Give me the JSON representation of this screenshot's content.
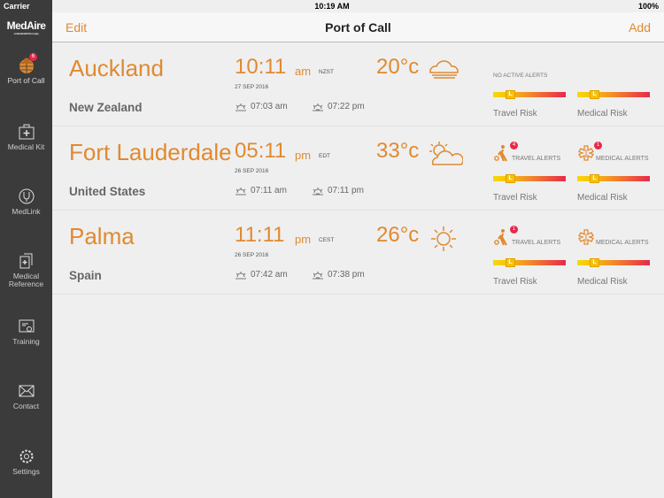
{
  "status": {
    "carrier": "Carrier",
    "time": "10:19 AM",
    "battery": "100%"
  },
  "brand": {
    "logo": "MedAire",
    "tagline": "An International SOS Company"
  },
  "sidebar": {
    "items": [
      {
        "label": "Port of Call",
        "icon": "globe-pin-icon",
        "badge": "6"
      },
      {
        "label": "Medical Kit",
        "icon": "medical-kit-icon"
      },
      {
        "label": "MedLink",
        "icon": "stethoscope-icon"
      },
      {
        "label": "Medical Reference",
        "icon": "documents-icon"
      },
      {
        "label": "Training",
        "icon": "certificate-icon"
      },
      {
        "label": "Contact",
        "icon": "envelope-icon"
      },
      {
        "label": "Settings",
        "icon": "gear-icon"
      }
    ]
  },
  "navbar": {
    "edit": "Edit",
    "title": "Port of Call",
    "add": "Add"
  },
  "colors": {
    "accent": "#e08a30",
    "sidebar": "#3b3b3b",
    "badge": "#e8284a"
  },
  "ports": [
    {
      "city": "Auckland",
      "country": "New Zealand",
      "time": "10:11",
      "ampm": "am",
      "tz": "NZST",
      "date": "27 SEP 2016",
      "sunrise": "07:03 am",
      "sunset": "07:22 pm",
      "temp": "20°c",
      "weather": "fog-icon",
      "no_alerts": "NO ACTIVE ALERTS",
      "travel_risk": "Travel Risk",
      "medical_risk": "Medical Risk",
      "risk_level": "L"
    },
    {
      "city": "Fort Lauderdale",
      "country": "United States",
      "time": "05:11",
      "ampm": "pm",
      "tz": "EDT",
      "date": "26 SEP 2016",
      "sunrise": "07:11 am",
      "sunset": "07:11 pm",
      "temp": "33°c",
      "weather": "partly-cloudy-icon",
      "travel_alerts": "TRAVEL ALERTS",
      "travel_count": "4",
      "medical_alerts": "MEDICAL ALERTS",
      "medical_count": "1",
      "travel_risk": "Travel Risk",
      "medical_risk": "Medical Risk",
      "risk_level": "L"
    },
    {
      "city": "Palma",
      "country": "Spain",
      "time": "11:11",
      "ampm": "pm",
      "tz": "CEST",
      "date": "26 SEP 2016",
      "sunrise": "07:42 am",
      "sunset": "07:38 pm",
      "temp": "26°c",
      "weather": "sun-icon",
      "travel_alerts": "TRAVEL ALERTS",
      "travel_count": "1",
      "medical_alerts": "MEDICAL ALERTS",
      "travel_risk": "Travel Risk",
      "medical_risk": "Medical Risk",
      "risk_level": "L"
    }
  ]
}
